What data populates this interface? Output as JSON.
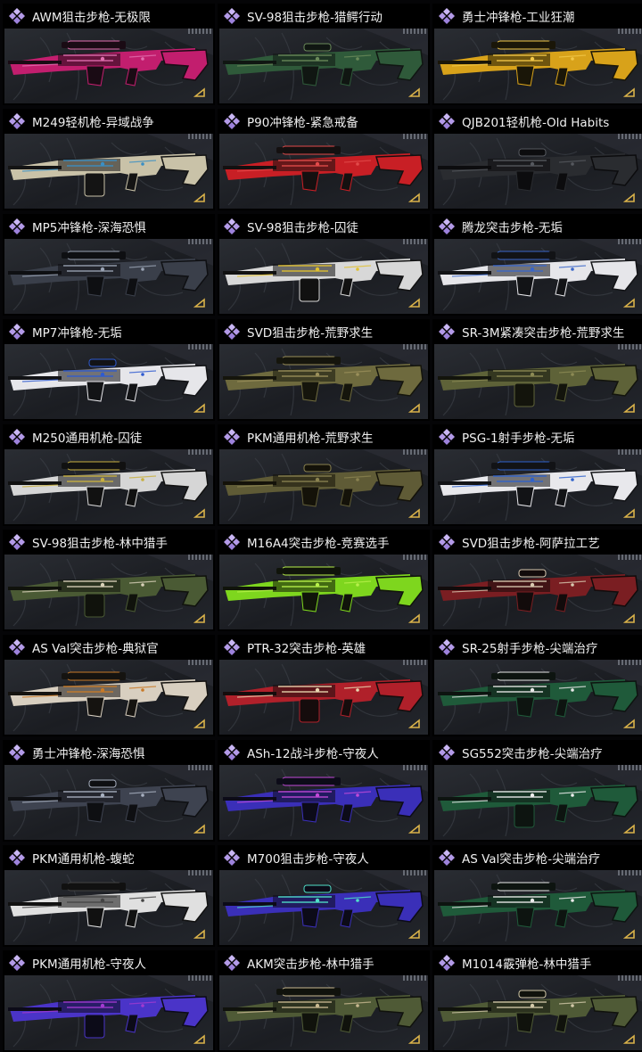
{
  "items": [
    {
      "name": "AWM狙击步枪-无极限",
      "colors": [
        "#c21e6e",
        "#1a0b14",
        "#e26fb0"
      ]
    },
    {
      "name": "SV-98狙击步枪-猎鳄行动",
      "colors": [
        "#2f5a3a",
        "#101612",
        "#6a8a5a"
      ]
    },
    {
      "name": "勇士冲锋枪-工业狂潮",
      "colors": [
        "#d8a21a",
        "#1a1608",
        "#f2c848"
      ]
    },
    {
      "name": "M249轻机枪-异域战争",
      "colors": [
        "#c9c2a8",
        "#141414",
        "#3a8fc4"
      ]
    },
    {
      "name": "P90冲锋枪-紧急戒备",
      "colors": [
        "#c81f25",
        "#141010",
        "#e24a4a"
      ]
    },
    {
      "name": "QJB201轻机枪-Old Habits",
      "colors": [
        "#2a2c30",
        "#0c0c0e",
        "#55585e"
      ]
    },
    {
      "name": "MP5冲锋枪-深海恐惧",
      "colors": [
        "#3a3f4a",
        "#0e0f12",
        "#9aa3b4"
      ]
    },
    {
      "name": "SV-98狙击步枪-囚徒",
      "colors": [
        "#d8d8d8",
        "#111111",
        "#e0c030"
      ]
    },
    {
      "name": "腾龙突击步枪-无垢",
      "colors": [
        "#e6e6ea",
        "#121316",
        "#3a66c8"
      ]
    },
    {
      "name": "MP7冲锋枪-无垢",
      "colors": [
        "#e6e6ea",
        "#121316",
        "#2f5bd0"
      ]
    },
    {
      "name": "SVD狙击步枪-荒野求生",
      "colors": [
        "#6e6a3e",
        "#15150c",
        "#9a8f5a"
      ]
    },
    {
      "name": "SR-3M紧凑突击步枪-荒野求生",
      "colors": [
        "#5e6238",
        "#13140c",
        "#8c8a54"
      ]
    },
    {
      "name": "M250通用机枪-囚徒",
      "colors": [
        "#d6d6d6",
        "#111111",
        "#c8b040"
      ]
    },
    {
      "name": "PKM通用机枪-荒野求生",
      "colors": [
        "#5f5b36",
        "#141209",
        "#8a8250"
      ]
    },
    {
      "name": "PSG-1射手步枪-无垢",
      "colors": [
        "#e8e8ec",
        "#121316",
        "#2f62cc"
      ]
    },
    {
      "name": "SV-98狙击步枪-林中猎手",
      "colors": [
        "#4a5a34",
        "#10120c",
        "#d8d0b8"
      ]
    },
    {
      "name": "M16A4突击步枪-竞赛选手",
      "colors": [
        "#7ed61e",
        "#10140a",
        "#b7f04a"
      ]
    },
    {
      "name": "SVD狙击步枪-阿萨拉工艺",
      "colors": [
        "#7a1e22",
        "#120b0b",
        "#d8c8b0"
      ]
    },
    {
      "name": "AS Val突击步枪-典狱官",
      "colors": [
        "#d8cfc0",
        "#151310",
        "#c87a28"
      ]
    },
    {
      "name": "PTR-32突击步枪-英雄",
      "colors": [
        "#b0202a",
        "#150c0c",
        "#e8d6b0"
      ]
    },
    {
      "name": "SR-25射手步枪-尖端治疗",
      "colors": [
        "#1f5a3a",
        "#0d1410",
        "#e8e8e8"
      ]
    },
    {
      "name": "勇士冲锋枪-深海恐惧",
      "colors": [
        "#3e4350",
        "#0e0f12",
        "#a8b0c0"
      ]
    },
    {
      "name": "ASh-12战斗步枪-守夜人",
      "colors": [
        "#3a2fb8",
        "#0c0b18",
        "#c24ad8"
      ]
    },
    {
      "name": "SG552突击步枪-尖端治疗",
      "colors": [
        "#1f5a3a",
        "#0d1410",
        "#eeeeee"
      ]
    },
    {
      "name": "PKM通用机枪-蝮蛇",
      "colors": [
        "#e0e0e0",
        "#111111",
        "#444444"
      ]
    },
    {
      "name": "M700狙击步枪-守夜人",
      "colors": [
        "#3a2fb8",
        "#0c0b18",
        "#50e0c8"
      ]
    },
    {
      "name": "AS Val突击步枪-尖端治疗",
      "colors": [
        "#1f5a3a",
        "#0d1410",
        "#ececec"
      ]
    },
    {
      "name": "PKM通用机枪-守夜人",
      "colors": [
        "#4a34c8",
        "#0c0b18",
        "#a23ad0"
      ]
    },
    {
      "name": "AKM突击步枪-林中猎手",
      "colors": [
        "#4f5a36",
        "#10120c",
        "#c8b890"
      ]
    },
    {
      "name": "M1014霰弹枪-林中猎手",
      "colors": [
        "#4f5a36",
        "#10120c",
        "#d2c8a8"
      ]
    }
  ],
  "icons": {
    "rarity": "purple-diamond-icon",
    "corner": "gold-chevron-icon"
  },
  "accent": "#b9a0f0"
}
